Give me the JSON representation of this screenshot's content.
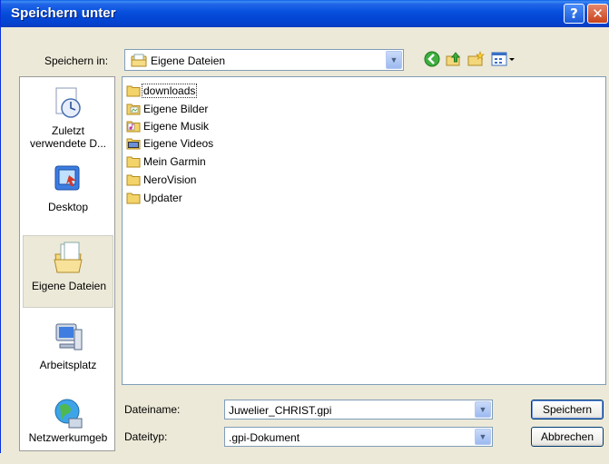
{
  "window": {
    "title": "Speichern unter"
  },
  "save_in": {
    "label": "Speichern in:",
    "value": "Eigene Dateien"
  },
  "places": [
    {
      "label": "Zuletzt verwendete D...",
      "icon": "recent-icon"
    },
    {
      "label": "Desktop",
      "icon": "desktop-icon"
    },
    {
      "label": "Eigene Dateien",
      "icon": "my-documents-icon",
      "selected": true
    },
    {
      "label": "Arbeitsplatz",
      "icon": "computer-icon"
    },
    {
      "label": "Netzwerkumgeb",
      "icon": "network-icon"
    }
  ],
  "files": [
    {
      "name": "downloads",
      "icon": "folder-icon"
    },
    {
      "name": "Eigene Bilder",
      "icon": "pictures-folder-icon"
    },
    {
      "name": "Eigene Musik",
      "icon": "music-folder-icon"
    },
    {
      "name": "Eigene Videos",
      "icon": "videos-folder-icon"
    },
    {
      "name": "Mein Garmin",
      "icon": "folder-icon"
    },
    {
      "name": "NeroVision",
      "icon": "folder-icon"
    },
    {
      "name": "Updater",
      "icon": "folder-icon"
    }
  ],
  "filename": {
    "label": "Dateiname:",
    "value": "Juwelier_CHRIST.gpi"
  },
  "filetype": {
    "label": "Dateityp:",
    "value": ".gpi-Dokument"
  },
  "buttons": {
    "save": "Speichern",
    "cancel": "Abbrechen"
  },
  "colors": {
    "title_bar": "#0a53e0",
    "dialog_bg": "#ece9d8",
    "field_border": "#7f9db9"
  }
}
